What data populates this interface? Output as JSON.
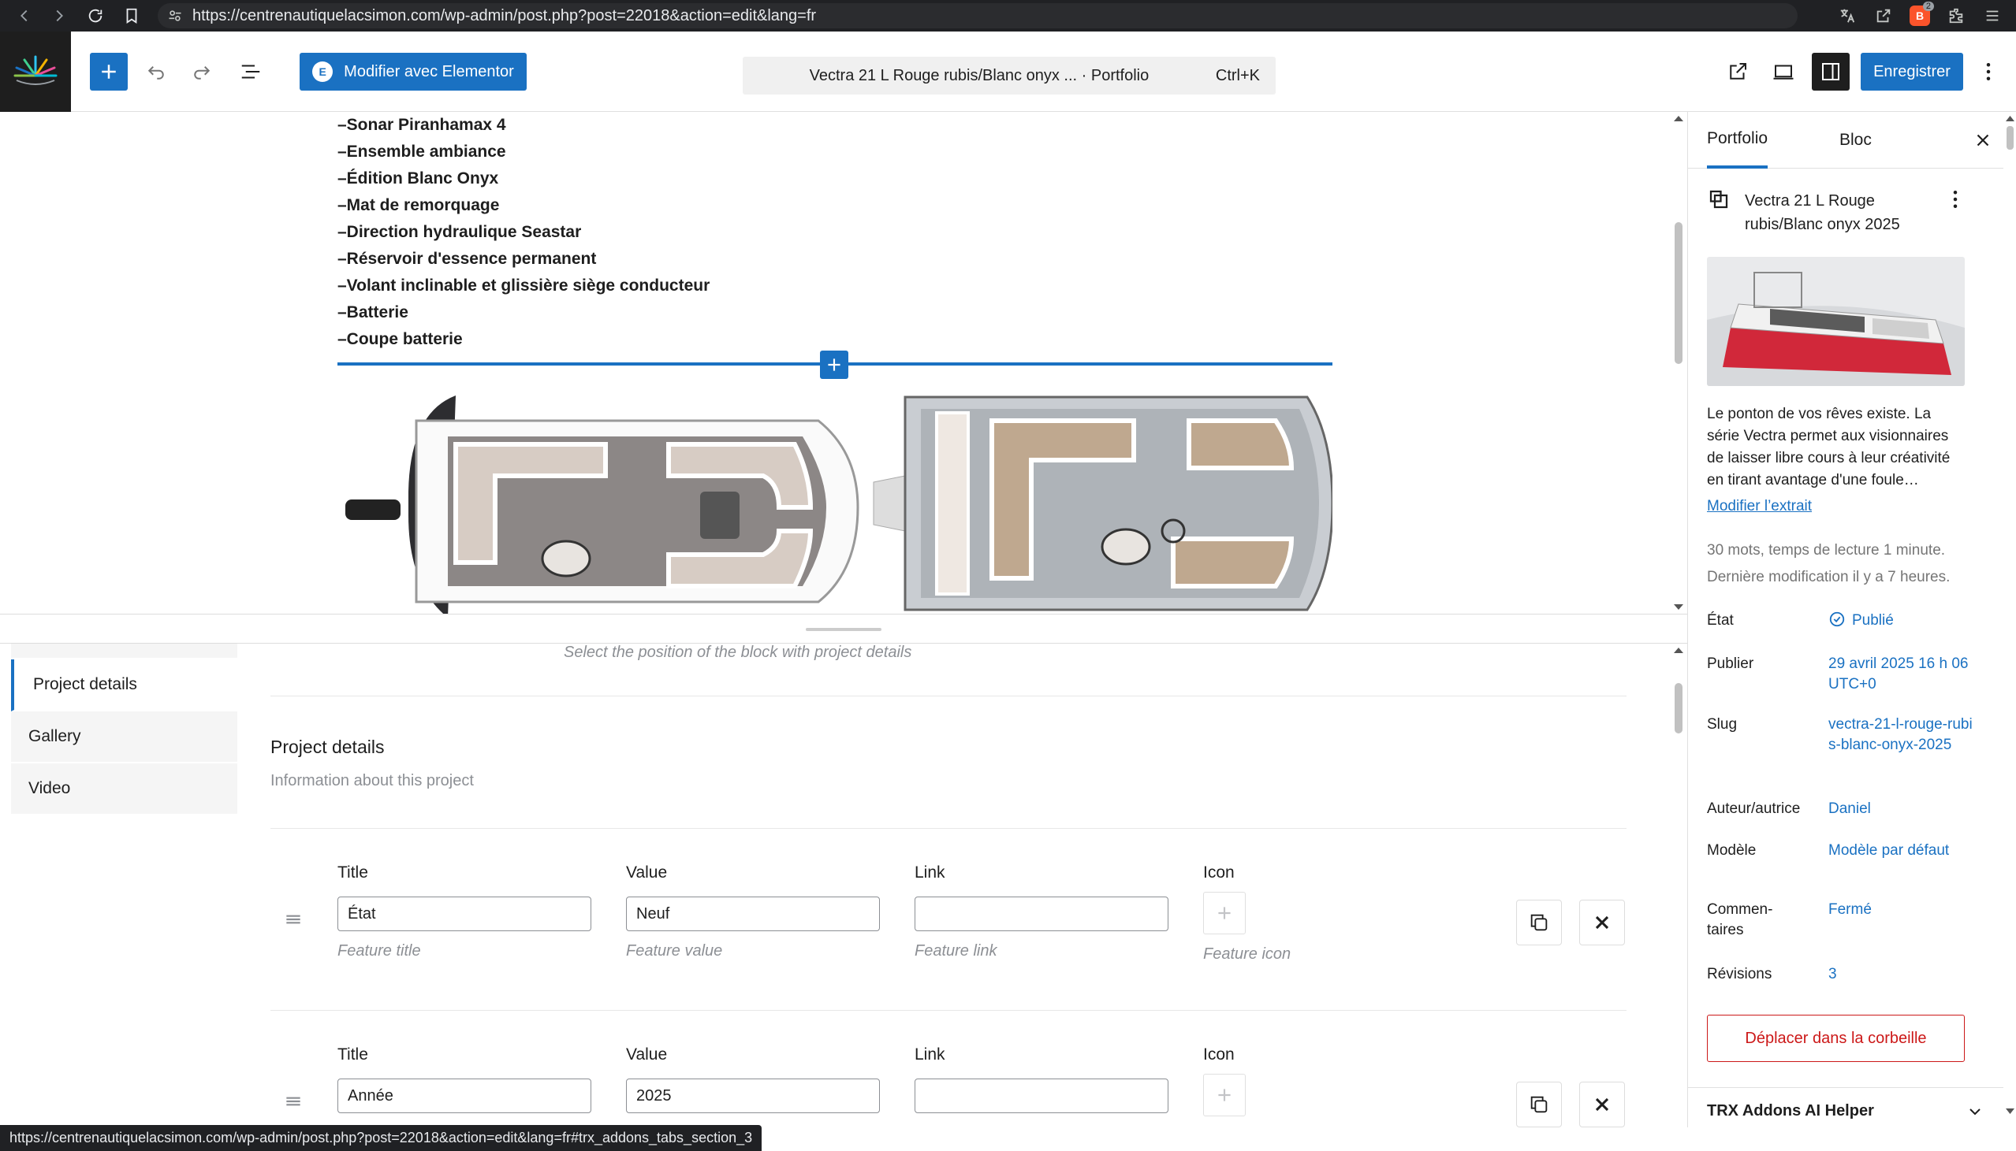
{
  "browser": {
    "url": "https://centrenautiquelacsimon.com/wp-admin/post.php?post=22018&action=edit&lang=fr",
    "extension_badge": "2"
  },
  "header": {
    "elementor_label": "Modifier avec Elementor",
    "elementor_icon": "E",
    "command_title": "Vectra 21 L Rouge rubis/Blanc onyx ... · Portfolio",
    "command_shortcut": "Ctrl+K",
    "save_label": "Enregistrer"
  },
  "canvas": {
    "spec_items": [
      "–Sonar Piranhamax 4",
      "–Ensemble ambiance",
      "–Édition Blanc Onyx",
      "–Mat de remorquage",
      "–Direction hydraulique Seastar",
      "–Réservoir d'essence permanent",
      "–Volant inclinable et glissière siège conducteur",
      "–Batterie",
      "–Coupe batterie"
    ]
  },
  "meta": {
    "position_hint": "Select the position of the block with project details",
    "tabs": [
      "",
      "Project details",
      "Gallery",
      "Video"
    ],
    "section_title": "Project details",
    "section_desc": "Information about this project",
    "columns": {
      "title": "Title",
      "value": "Value",
      "link": "Link",
      "icon": "Icon"
    },
    "hints": {
      "title": "Feature title",
      "value": "Feature value",
      "link": "Feature link",
      "icon": "Feature icon"
    },
    "rows": [
      {
        "title": "État",
        "value": "Neuf",
        "link": ""
      },
      {
        "title": "Année",
        "value": "2025",
        "link": ""
      }
    ]
  },
  "sidebar": {
    "tab_post": "Portfolio",
    "tab_block": "Bloc",
    "post_title": "Vectra 21 L Rouge rubis/Blanc onyx 2025",
    "excerpt": "Le ponton de vos rêves existe. La série Vectra permet aux visionnaires de laisser libre cours à leur créativité en tirant avantage d'une foule…",
    "excerpt_link": "Modifier l’extrait",
    "stats_words": "30 mots, temps de lecture 1 minute.",
    "stats_modified": "Dernière modification il y a 7 heures.",
    "fields": [
      {
        "key": "État",
        "value": "Publié"
      },
      {
        "key": "Publier",
        "value": "29 avril 2025 16 h 06 UTC+0"
      },
      {
        "key": "Slug",
        "value": "vectra-21-l-rouge-rubis-blanc-onyx-2025"
      },
      {
        "key": "Auteur/autrice",
        "value": "Daniel"
      },
      {
        "key": "Modèle",
        "value": "Modèle par défaut"
      },
      {
        "key": "Commen-taires",
        "value": "Fermé"
      },
      {
        "key": "Révisions",
        "value": "3"
      }
    ],
    "trash_label": "Déplacer dans la corbeille",
    "panel_title": "TRX Addons AI Helper"
  },
  "status_bar": {
    "hover_url": "https://centrenautiquelacsimon.com/wp-admin/post.php?post=22018&action=edit&lang=fr#trx_addons_tabs_section_3"
  },
  "colors": {
    "accent": "#1a71c2",
    "danger": "#cc1818",
    "chrome": "#202124"
  },
  "icons": {
    "back": "arrow-left-icon",
    "forward": "arrow-right-icon",
    "reload": "reload-icon",
    "bookmark": "bookmark-icon",
    "translate": "translate-icon",
    "share": "share-icon",
    "extensions": "puzzle-icon",
    "menu": "kebab-icon"
  }
}
